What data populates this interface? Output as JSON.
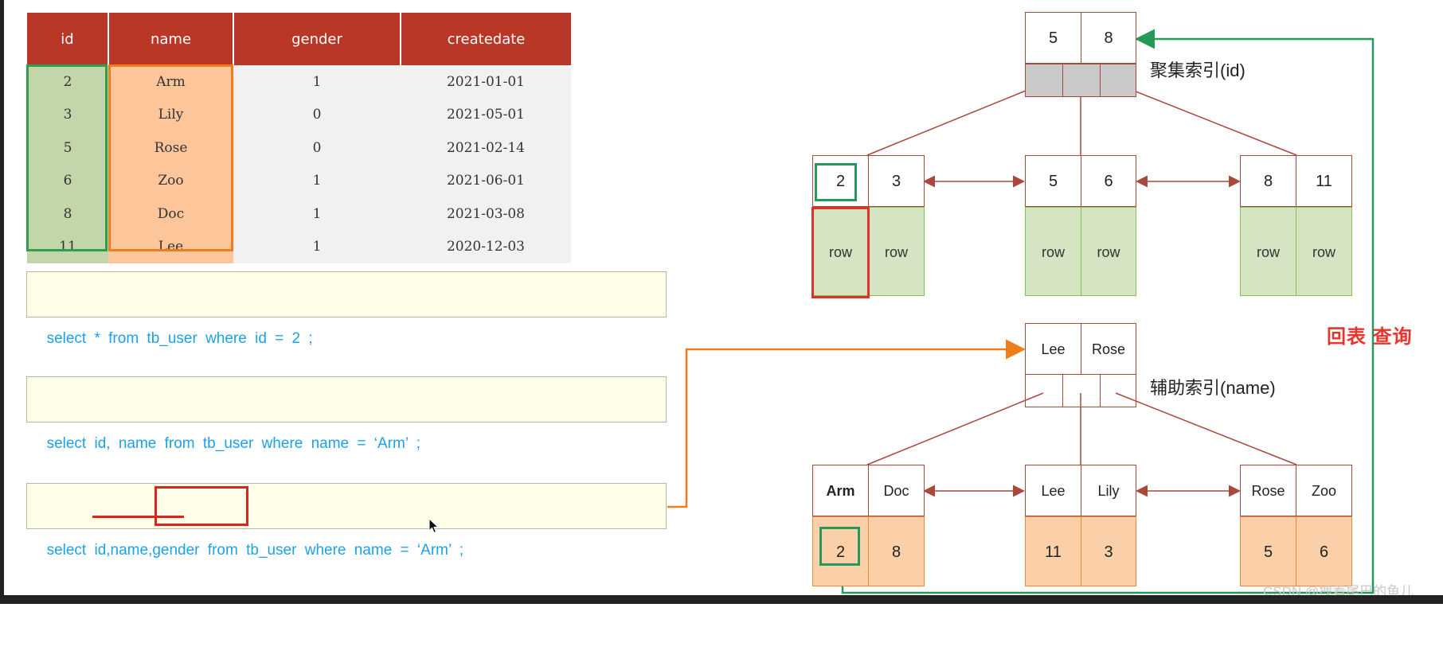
{
  "table": {
    "headers": [
      "id",
      "name",
      "gender",
      "createdate"
    ],
    "rows": [
      [
        "2",
        "Arm",
        "1",
        "2021-01-01"
      ],
      [
        "3",
        "Lily",
        "0",
        "2021-05-01"
      ],
      [
        "5",
        "Rose",
        "0",
        "2021-02-14"
      ],
      [
        "6",
        "Zoo",
        "1",
        "2021-06-01"
      ],
      [
        "8",
        "Doc",
        "1",
        "2021-03-08"
      ],
      [
        "11",
        "Lee",
        "1",
        "2020-12-03"
      ]
    ]
  },
  "queries": [
    "select * from tb_user where id = 2 ;",
    "select id, name from tb_user where name = ‘Arm’ ;",
    "select id,name,gender from tb_user where name = ‘Arm’ ;"
  ],
  "clustered_index": {
    "label": "聚集索引(id)",
    "root_keys": [
      "5",
      "8"
    ],
    "leaves": [
      {
        "keys": [
          "2",
          "3"
        ],
        "data": [
          "row",
          "row"
        ]
      },
      {
        "keys": [
          "5",
          "6"
        ],
        "data": [
          "row",
          "row"
        ]
      },
      {
        "keys": [
          "8",
          "11"
        ],
        "data": [
          "row",
          "row"
        ]
      }
    ]
  },
  "secondary_index": {
    "label": "辅助索引(name)",
    "root_keys": [
      "Lee",
      "Rose"
    ],
    "leaves": [
      {
        "keys": [
          "Arm",
          "Doc"
        ],
        "data": [
          "2",
          "8"
        ]
      },
      {
        "keys": [
          "Lee",
          "Lily"
        ],
        "data": [
          "11",
          "3"
        ]
      },
      {
        "keys": [
          "Rose",
          "Zoo"
        ],
        "data": [
          "5",
          "6"
        ]
      }
    ]
  },
  "back_to_table_label": "回表 查询",
  "watermark": "CSDN @拽着尾巴的鱼儿",
  "colors": {
    "header_red": "#b83727",
    "id_green": "#c3d6a9",
    "name_orange": "#fdc59a",
    "highlight_green": "#24995a",
    "highlight_red": "#e23028",
    "arrow_orange": "#ef7d1b",
    "sql_blue": "#1da1e8"
  }
}
